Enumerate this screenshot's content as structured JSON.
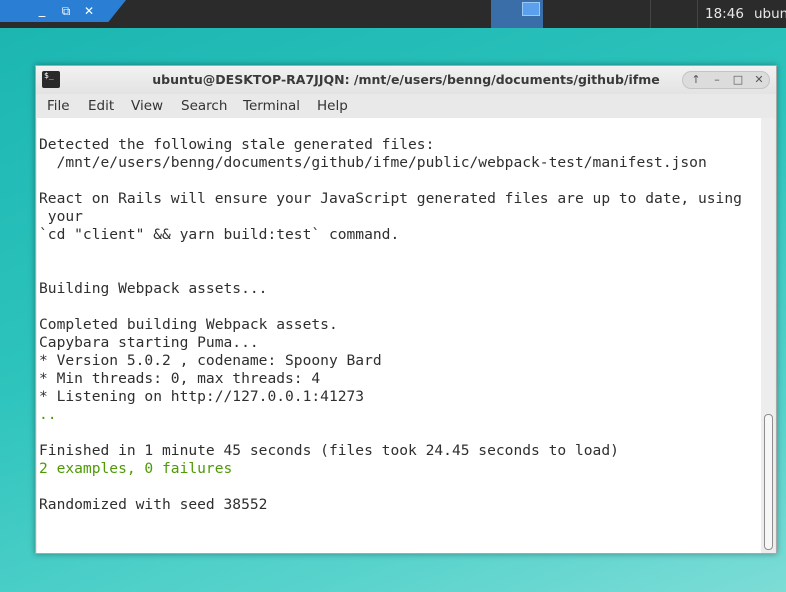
{
  "panel": {
    "minimize_glyph": "_",
    "restore_glyph": "⧉",
    "close_glyph": "✕",
    "clock": "18:46",
    "user": "ubuntu"
  },
  "window": {
    "title": "ubuntu@DESKTOP-RA7JJQN: /mnt/e/users/benng/documents/github/ifme",
    "icon_text": "$_",
    "controls": {
      "up": "↑",
      "minimize": "–",
      "maximize": "□",
      "close": "✕"
    }
  },
  "menu": [
    "File",
    "Edit",
    "View",
    "Search",
    "Terminal",
    "Help"
  ],
  "terminal": {
    "lines": [
      {
        "text": "Detected the following stale generated files:",
        "color": "default"
      },
      {
        "text": "  /mnt/e/users/benng/documents/github/ifme/public/webpack-test/manifest.json",
        "color": "default"
      },
      {
        "text": "",
        "color": "default"
      },
      {
        "text": "React on Rails will ensure your JavaScript generated files are up to date, using",
        "color": "default"
      },
      {
        "text": " your",
        "color": "default"
      },
      {
        "text": "`cd \"client\" && yarn build:test` command.",
        "color": "default"
      },
      {
        "text": "",
        "color": "default"
      },
      {
        "text": "",
        "color": "default"
      },
      {
        "text": "Building Webpack assets...",
        "color": "default"
      },
      {
        "text": "",
        "color": "default"
      },
      {
        "text": "Completed building Webpack assets.",
        "color": "default"
      },
      {
        "text": "Capybara starting Puma...",
        "color": "default"
      },
      {
        "text": "* Version 5.0.2 , codename: Spoony Bard",
        "color": "default"
      },
      {
        "text": "* Min threads: 0, max threads: 4",
        "color": "default"
      },
      {
        "text": "* Listening on http://127.0.0.1:41273",
        "color": "default"
      },
      {
        "text": "..",
        "color": "green"
      },
      {
        "text": "",
        "color": "default"
      },
      {
        "text": "Finished in 1 minute 45 seconds (files took 24.45 seconds to load)",
        "color": "default"
      },
      {
        "text": "2 examples, 0 failures",
        "color": "green"
      },
      {
        "text": "",
        "color": "default"
      },
      {
        "text": "Randomized with seed 38552",
        "color": "default"
      }
    ]
  },
  "colors": {
    "accent": "#2a7fd4",
    "terminal_green": "#4e9a06",
    "desktop": "#2ec4bd"
  }
}
